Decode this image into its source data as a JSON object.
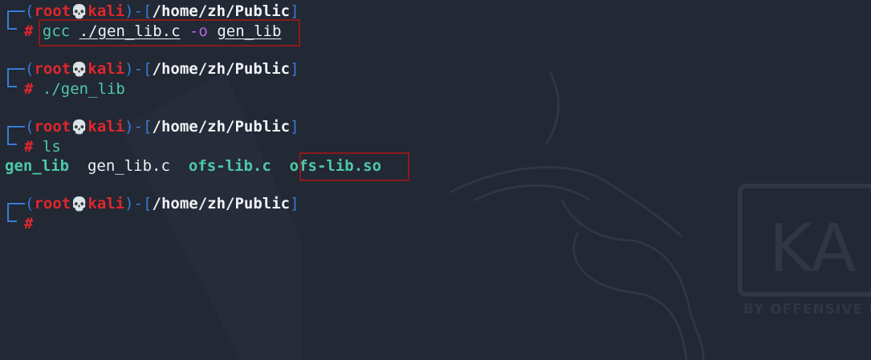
{
  "prompts": [
    {
      "user": "root",
      "skull": "💀",
      "host": "kali",
      "path": "/home/zh/Public",
      "symbol": "#",
      "command": ""
    },
    {
      "user": "root",
      "skull": "💀",
      "host": "kali",
      "path": "/home/zh/Public",
      "symbol": "#",
      "command": "./gen_lib"
    },
    {
      "user": "root",
      "skull": "💀",
      "host": "kali",
      "path": "/home/zh/Public",
      "symbol": "#",
      "command": "ls"
    },
    {
      "user": "root",
      "skull": "💀",
      "host": "kali",
      "path": "/home/zh/Public",
      "symbol": "#",
      "command": ""
    }
  ],
  "gcc_command": {
    "cmd": "gcc",
    "arg1": "./gen_lib.c",
    "flag": "-o",
    "arg2": "gen_lib"
  },
  "ls_output": [
    "gen_lib",
    "gen_lib.c",
    "ofs-lib.c",
    "ofs-lib.so"
  ],
  "punct": {
    "open": "(",
    "close": ")",
    "dash": "-",
    "lbr": "[",
    "rbr": "]"
  },
  "watermark": {
    "text": "KA",
    "subtext": "BY OFFENSIVE S"
  },
  "colors": {
    "background": "#222834",
    "prompt_blue": "#3a7bd5",
    "user_red": "#e0272c",
    "command_green": "#4ec9a8",
    "flag_purple": "#b267e6",
    "highlight_border": "#8b1a1a"
  }
}
